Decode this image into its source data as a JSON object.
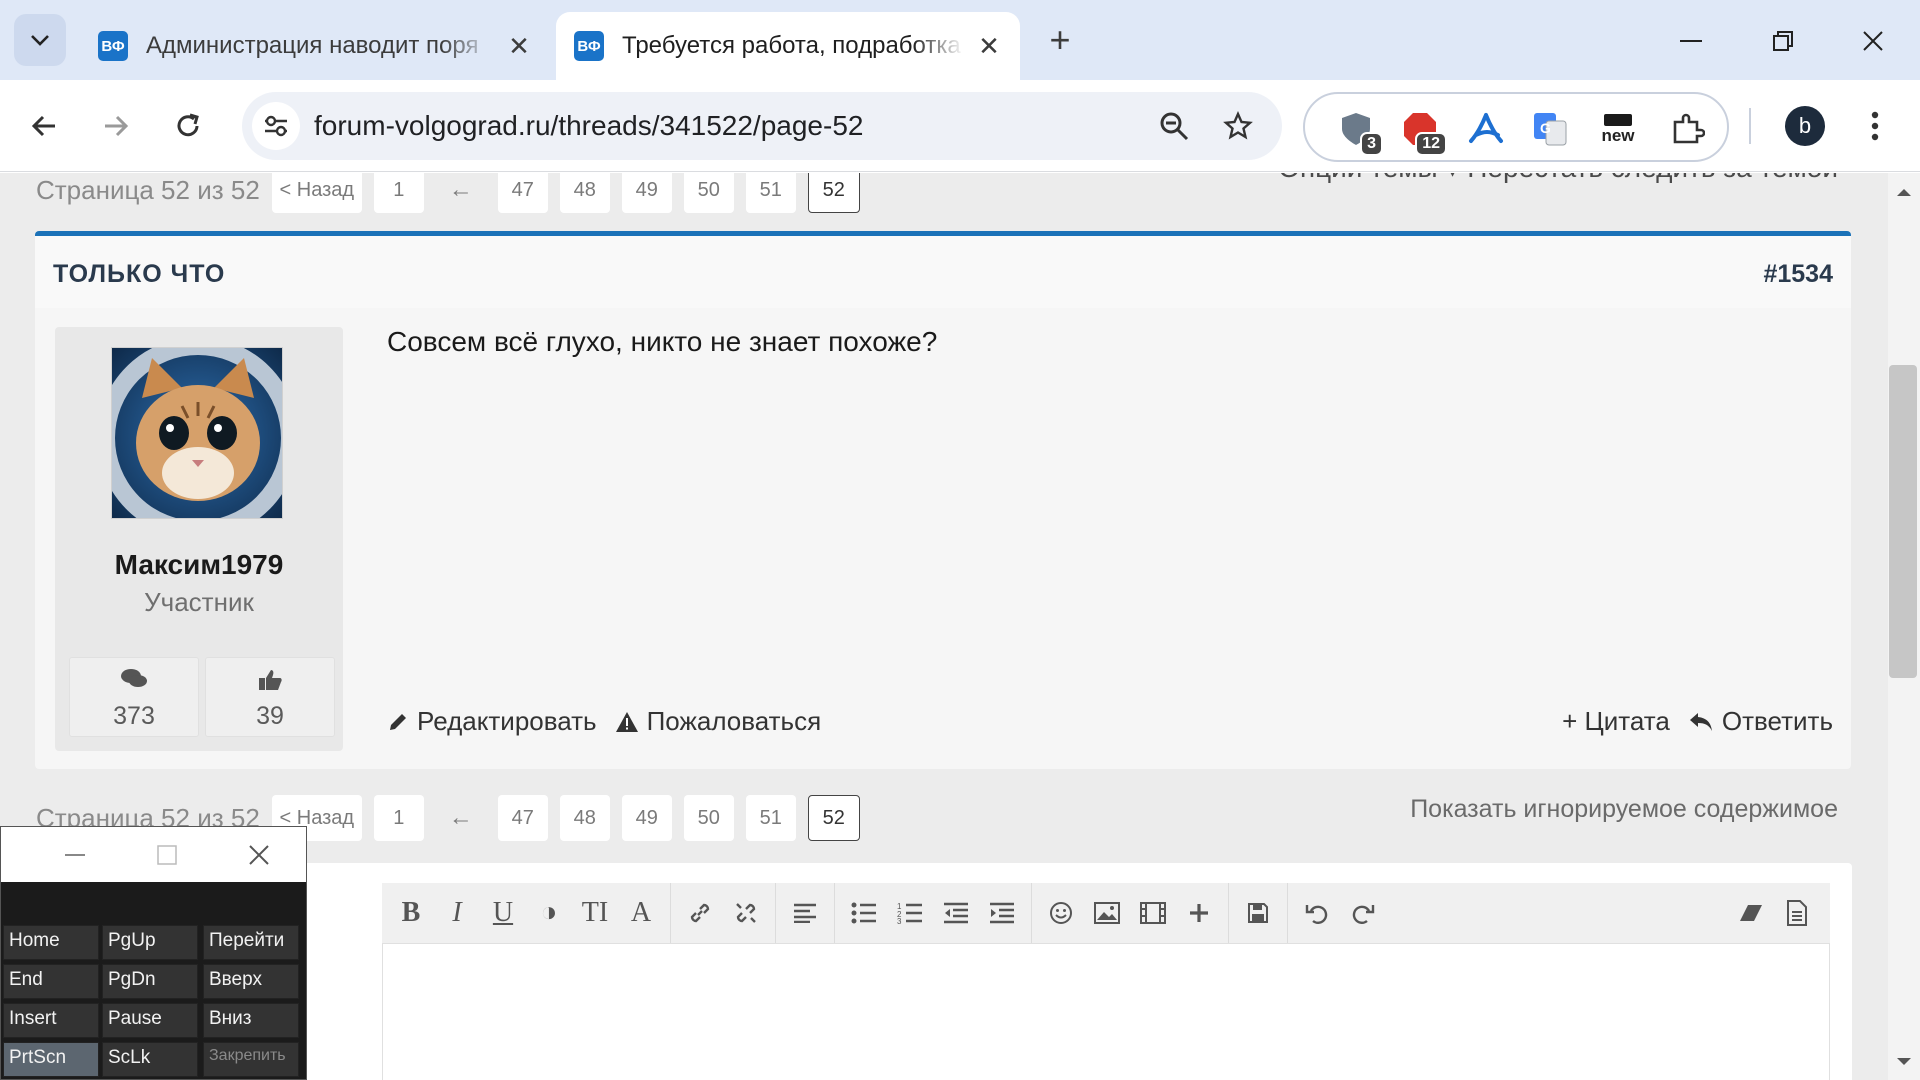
{
  "browser": {
    "tabs": [
      {
        "title": "Администрация наводит поря",
        "favicon": "ВФ",
        "active": false
      },
      {
        "title": "Требуется работа, подработка",
        "favicon": "ВФ",
        "active": true
      }
    ],
    "url": "forum-volgograd.ru/threads/341522/page-52",
    "extensions": [
      {
        "name": "shield-icon",
        "badge": "3"
      },
      {
        "name": "adblock-icon",
        "badge": "12"
      },
      {
        "name": "acrobat-icon",
        "badge": ""
      },
      {
        "name": "translate-icon",
        "badge": ""
      },
      {
        "name": "pocket-new-icon",
        "badge": "new"
      }
    ],
    "profile_initial": "b"
  },
  "thread": {
    "page_label": "Страница 52 из 52",
    "prev_label": "< Назад",
    "pages": [
      "1",
      "←",
      "47",
      "48",
      "49",
      "50",
      "51",
      "52"
    ],
    "current_page": "52",
    "options_text": "Опции темы ▾   Перестать следить за темой",
    "show_ignored": "Показать игнорируемое содержимое"
  },
  "post": {
    "time": "ТОЛЬКО ЧТО",
    "number": "#1534",
    "author": "Максим1979",
    "author_title": "Участник",
    "messages_count": "373",
    "likes_count": "39",
    "body": "Совсем всё глухо, никто не знает похоже?",
    "actions": {
      "edit": "Редактировать",
      "report": "Пожаловаться",
      "quote": "+ Цитата",
      "reply": "Ответить"
    }
  },
  "editor": {
    "buttons": [
      "B",
      "I",
      "U",
      "◑",
      "TI",
      "A"
    ]
  },
  "osk": {
    "keys": [
      [
        "Home",
        "PgUp",
        "Перейти"
      ],
      [
        "End",
        "PgDn",
        "Вверх"
      ],
      [
        "Insert",
        "Pause",
        "Вниз"
      ],
      [
        "PrtScn",
        "ScLk",
        "Закрепить"
      ]
    ]
  }
}
